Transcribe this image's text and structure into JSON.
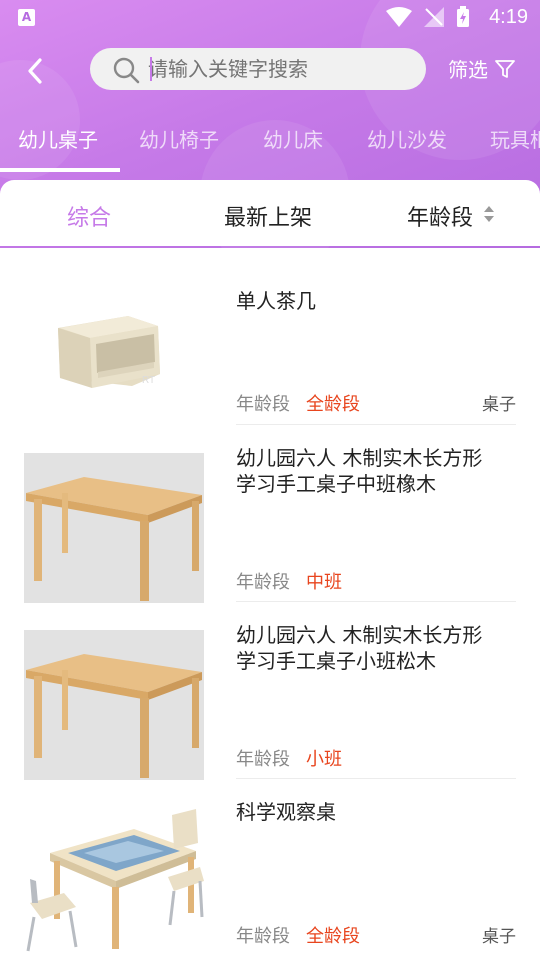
{
  "status": {
    "time": "4:19",
    "app_badge": "A"
  },
  "search": {
    "placeholder": "请输入关键字搜索"
  },
  "filter": {
    "label": "筛选"
  },
  "tabs": [
    {
      "label": "幼儿桌子"
    },
    {
      "label": "幼儿椅子"
    },
    {
      "label": "幼儿床"
    },
    {
      "label": "幼儿沙发"
    },
    {
      "label": "玩具柜"
    }
  ],
  "sort": {
    "comprehensive": "综合",
    "newest": "最新上架",
    "age": "年龄段"
  },
  "items": [
    {
      "title": "单人茶几",
      "meta_label": "年龄段",
      "meta_value": "全龄段",
      "tag": "桌子"
    },
    {
      "title": "幼儿园六人  木制实木长方形学习手工桌子中班橡木",
      "meta_label": "年龄段",
      "meta_value": "中班",
      "tag": ""
    },
    {
      "title": "幼儿园六人  木制实木长方形学习手工桌子小班松木",
      "meta_label": "年龄段",
      "meta_value": "小班",
      "tag": ""
    },
    {
      "title": "科学观察桌",
      "meta_label": "年龄段",
      "meta_value": "全龄段",
      "tag": "桌子"
    }
  ],
  "colors": {
    "accent": "#c67ae8",
    "price_red": "#e8451e",
    "header_start": "#d98cf0",
    "header_end": "#b56be0"
  },
  "icons": {
    "back": "chevron-left-icon",
    "search": "search-icon",
    "filter": "filter-funnel-icon",
    "sort": "sort-arrows-icon"
  }
}
